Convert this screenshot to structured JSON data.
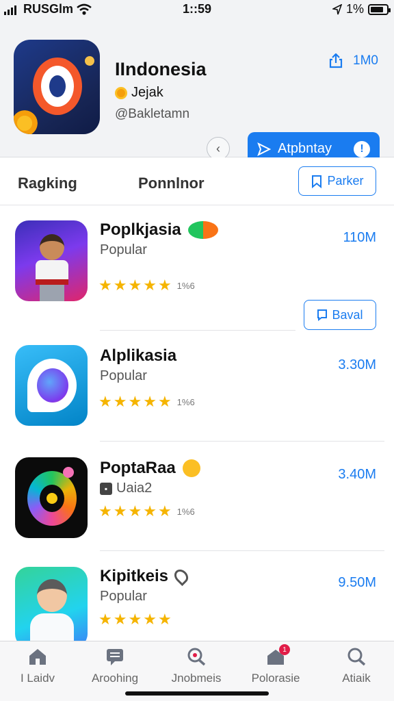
{
  "status_bar": {
    "carrier": "RUSGlm",
    "time": "1::59",
    "battery_text": "1%",
    "battery_level": 0.8
  },
  "app": {
    "title": "IIndonesia",
    "developer": "Jejak",
    "handle": "@Bakletamn",
    "share_label": "1M0",
    "get_label": "Atpbntay"
  },
  "segments": {
    "tab1": "Ragking",
    "tab2": "Ponnlnor",
    "park_button": "Parker"
  },
  "apps": [
    {
      "name": "Poplkjasia",
      "subtitle": "Popular",
      "stars": 5,
      "rating_count": "1%6",
      "size": "110M"
    },
    {
      "name": "Alplikasia",
      "subtitle": "Popular",
      "stars": 5,
      "rating_count": "1%6",
      "size": "3.30M"
    },
    {
      "name": "PoptaRaa",
      "subtitle": "Uaia2",
      "stars": 5,
      "rating_count": "1%6",
      "size": "3.40M"
    },
    {
      "name": "Kipitkeis",
      "subtitle": "Popular",
      "stars": 5,
      "size": "9.50M"
    }
  ],
  "install_button": "Baval",
  "tab_bar": {
    "items": [
      {
        "label": "I Laidv",
        "icon": "home-icon"
      },
      {
        "label": "Aroohing",
        "icon": "message-icon"
      },
      {
        "label": "Jnobmeis",
        "icon": "search-icon"
      },
      {
        "label": "Polorasie",
        "icon": "store-icon",
        "badge": "1"
      },
      {
        "label": "Atiaik",
        "icon": "search-icon"
      }
    ]
  },
  "colors": {
    "accent": "#1a7cf0",
    "star": "#f5b400"
  }
}
